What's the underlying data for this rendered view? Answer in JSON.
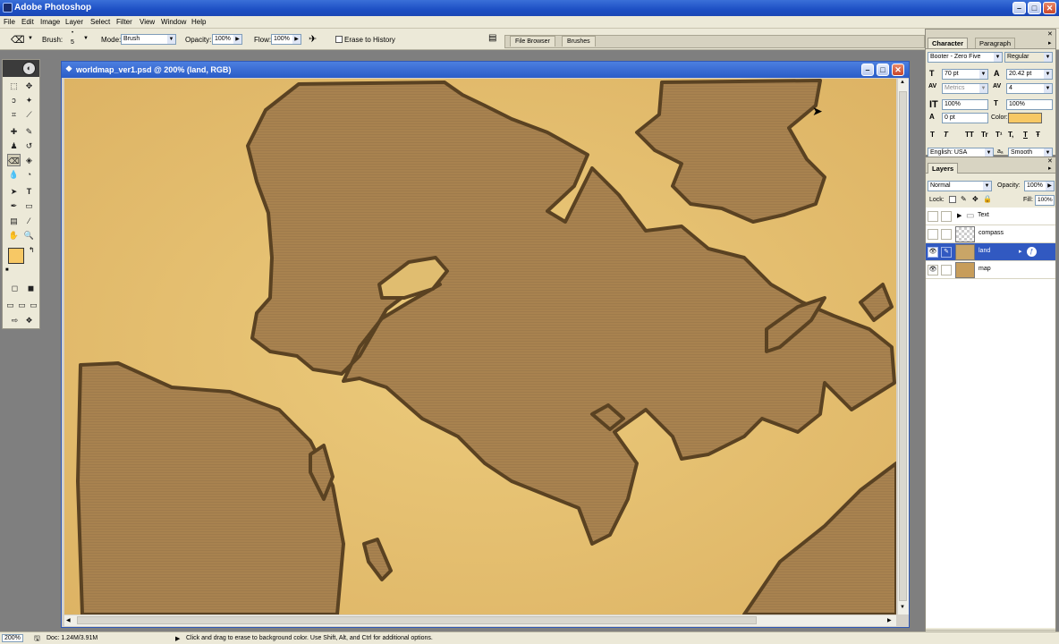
{
  "app": {
    "title": "Adobe Photoshop"
  },
  "menu": [
    "File",
    "Edit",
    "Image",
    "Layer",
    "Select",
    "Filter",
    "View",
    "Window",
    "Help"
  ],
  "options": {
    "brush_label": "Brush:",
    "brush_size": "5",
    "mode_label": "Mode:",
    "mode_value": "Brush",
    "opacity_label": "Opacity:",
    "opacity_value": "100%",
    "flow_label": "Flow:",
    "flow_value": "100%",
    "erase_history_label": "Erase to History",
    "tabs": [
      "File Browser",
      "Brushes"
    ]
  },
  "document": {
    "title": "worldmap_ver1.psd @ 200% (land, RGB)"
  },
  "character_panel": {
    "tabs": [
      "Character",
      "Paragraph"
    ],
    "font_family": "Booter - Zero Five",
    "font_style": "Regular",
    "font_size": "70 pt",
    "leading": "20.42 pt",
    "kerning": "Metrics",
    "tracking": "4",
    "vertical_scale": "100%",
    "horizontal_scale": "100%",
    "baseline_shift": "0 pt",
    "color_label": "Color:",
    "text_color": "#f7c865",
    "style_buttons": [
      "T",
      "T",
      "TT",
      "Tr",
      "T¹",
      "T,",
      "T",
      "Ŧ"
    ],
    "language": "English: USA",
    "antialias_label": "aₐ",
    "antialias": "Smooth"
  },
  "layers_panel": {
    "tab": "Layers",
    "blend_mode": "Normal",
    "opacity_label": "Opacity:",
    "opacity_value": "100%",
    "lock_label": "Lock:",
    "fill_label": "Fill:",
    "fill_value": "100%",
    "layers": [
      {
        "name": "Text",
        "type": "group",
        "visible": false,
        "selected": false
      },
      {
        "name": "compass",
        "type": "layer",
        "visible": false,
        "selected": false
      },
      {
        "name": "land",
        "type": "layer",
        "visible": true,
        "selected": true
      },
      {
        "name": "map",
        "type": "layer",
        "visible": true,
        "selected": false
      }
    ]
  },
  "status": {
    "zoom": "200%",
    "doc": "Doc: 1.24M/3.91M",
    "hint": "Click and drag to erase to background color.  Use Shift, Alt, and Ctrl for additional options."
  },
  "colors": {
    "foreground": "#f7c865",
    "background": "#ffffff",
    "land": "#a8824f",
    "sea": "#e7c06e",
    "outline": "#5a4222",
    "selection": "#3159c1"
  }
}
